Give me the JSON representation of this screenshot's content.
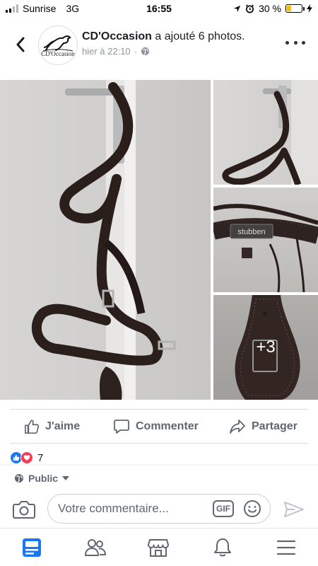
{
  "status_bar": {
    "carrier": "Sunrise",
    "network": "3G",
    "time": "16:55",
    "battery_percent": "30 %",
    "battery_level": 0.3,
    "signal_bars": 2
  },
  "post": {
    "page_name": "CD'Occasion",
    "action_text": " a ajouté 6 photos.",
    "timestamp": "hier à 22:10",
    "avatar_text": "CD'Occasion",
    "more_photos_label": "+3",
    "photo_brand_text": "stubben"
  },
  "actions": {
    "like_label": "J'aime",
    "comment_label": "Commenter",
    "share_label": "Partager"
  },
  "reactions": {
    "count": "7"
  },
  "composer": {
    "privacy_label": "Public",
    "placeholder": "Votre commentaire...",
    "gif_label": "GIF"
  },
  "tabs": [
    "news-feed-icon",
    "friends-icon",
    "marketplace-icon",
    "notifications-icon",
    "menu-icon"
  ],
  "colors": {
    "accent": "#1877f2",
    "love": "#f33e58",
    "battery": "#f2c200",
    "secondary_text": "#606770"
  }
}
